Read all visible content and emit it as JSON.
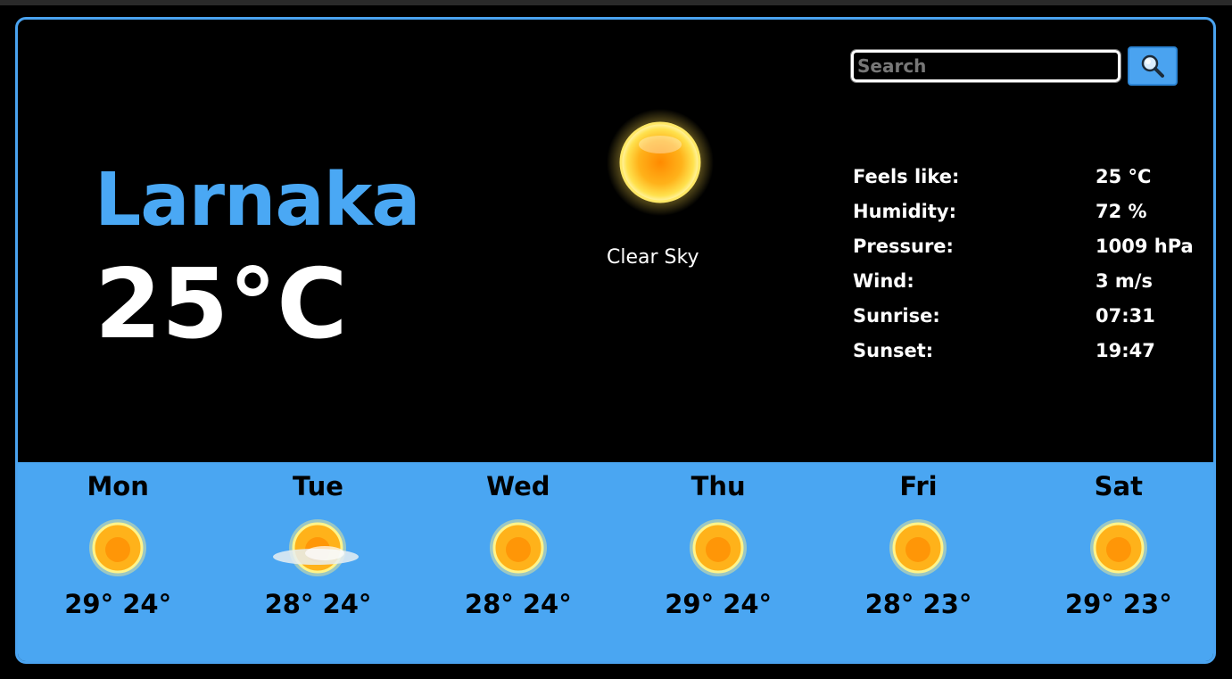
{
  "city": "Larnaka",
  "temperature": "25°C",
  "condition": "Clear Sky",
  "search": {
    "placeholder": "Search",
    "value": ""
  },
  "details": [
    {
      "label": "Feels like:",
      "value": "25 °C"
    },
    {
      "label": "Humidity:",
      "value": "72 %"
    },
    {
      "label": "Pressure:",
      "value": "1009 hPa"
    },
    {
      "label": "Wind:",
      "value": "3 m/s"
    },
    {
      "label": "Sunrise:",
      "value": "07:31"
    },
    {
      "label": "Sunset:",
      "value": "19:47"
    }
  ],
  "forecast": [
    {
      "day": "Mon",
      "icon": "sun-icon",
      "high": "29°",
      "low": "24°"
    },
    {
      "day": "Tue",
      "icon": "sun-cloud-icon",
      "high": "28°",
      "low": "24°"
    },
    {
      "day": "Wed",
      "icon": "sun-icon",
      "high": "28°",
      "low": "24°"
    },
    {
      "day": "Thu",
      "icon": "sun-icon",
      "high": "29°",
      "low": "24°"
    },
    {
      "day": "Fri",
      "icon": "sun-icon",
      "high": "28°",
      "low": "23°"
    },
    {
      "day": "Sat",
      "icon": "sun-icon",
      "high": "29°",
      "low": "23°"
    }
  ],
  "colors": {
    "accent": "#4aa3f0",
    "city": "#4aa8f4",
    "forecast_bg": "#4aa6f2",
    "background": "#000000"
  }
}
